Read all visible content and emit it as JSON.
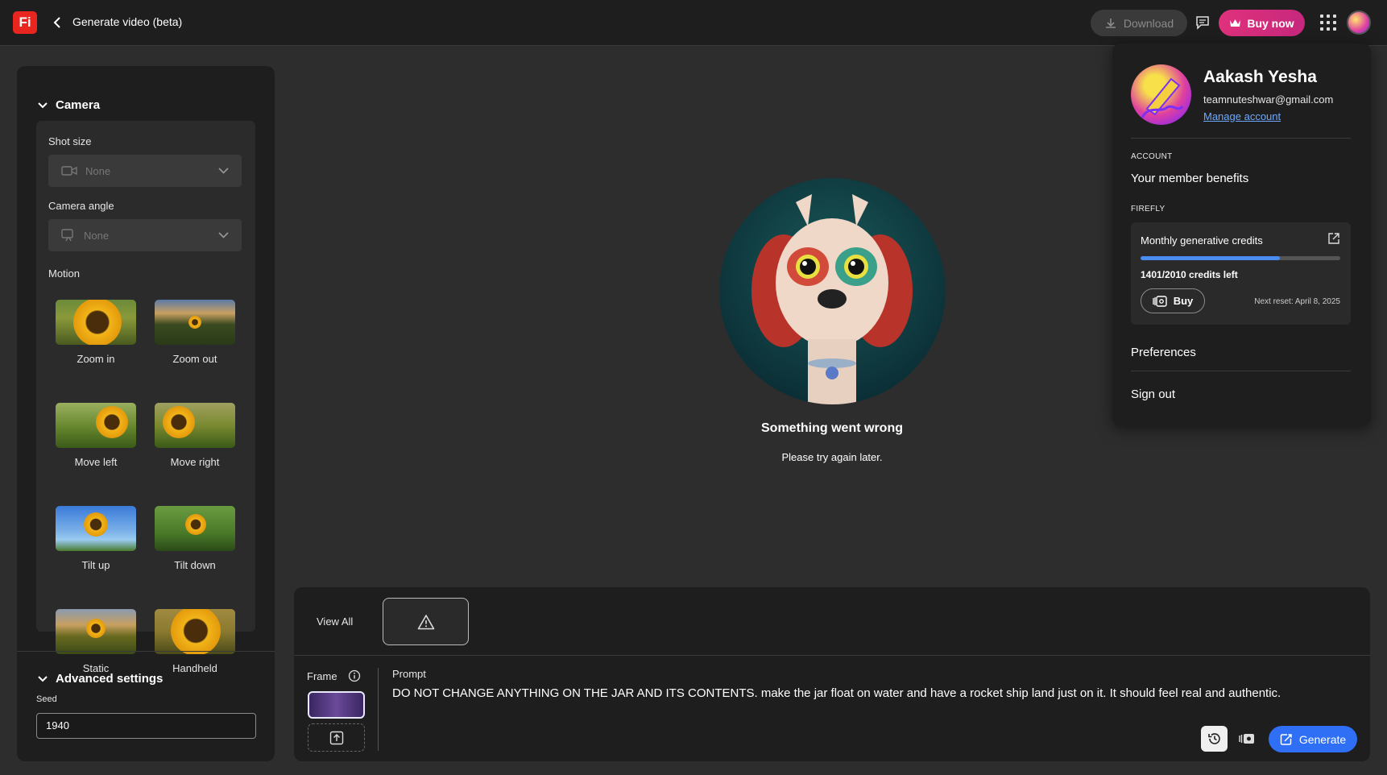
{
  "header": {
    "app_logo": "Fi",
    "title": "Generate video (beta)",
    "download_label": "Download",
    "buy_now_label": "Buy now"
  },
  "camera": {
    "section_title": "Camera",
    "shot_size_label": "Shot size",
    "shot_size_value": "None",
    "camera_angle_label": "Camera angle",
    "camera_angle_value": "None",
    "motion_label": "Motion",
    "motions": [
      {
        "label": "Zoom in"
      },
      {
        "label": "Zoom out"
      },
      {
        "label": "Move left"
      },
      {
        "label": "Move right"
      },
      {
        "label": "Tilt up"
      },
      {
        "label": "Tilt down"
      },
      {
        "label": "Static"
      },
      {
        "label": "Handheld"
      }
    ]
  },
  "advanced": {
    "section_title": "Advanced settings",
    "seed_label": "Seed",
    "seed_value": "1940"
  },
  "center": {
    "error_title": "Something went wrong",
    "error_subtitle": "Please try again later."
  },
  "prompt_panel": {
    "view_all_label": "View All",
    "frame_label": "Frame",
    "prompt_label": "Prompt",
    "prompt_text": "DO NOT CHANGE ANYTHING ON THE JAR AND ITS CONTENTS. make the jar float on water and have a rocket ship land just on it. It should feel real and authentic.",
    "generate_label": "Generate"
  },
  "account": {
    "name": "Aakash Yesha",
    "email": "teamnuteshwar@gmail.com",
    "manage_label": "Manage account",
    "account_section": "ACCOUNT",
    "member_benefits_label": "Your member benefits",
    "firefly_section": "FIREFLY",
    "credits_title": "Monthly generative credits",
    "credits_remaining": 1401,
    "credits_total": 2010,
    "credits_text": "1401/2010 credits left",
    "buy_label": "Buy",
    "next_reset": "Next reset: April 8, 2025",
    "preferences_label": "Preferences",
    "sign_out_label": "Sign out"
  },
  "colors": {
    "accent_blue": "#2f6ff5",
    "buy_now_pink": "#e0317c",
    "logo_red": "#e8261f",
    "link_blue": "#6ea9ff"
  }
}
